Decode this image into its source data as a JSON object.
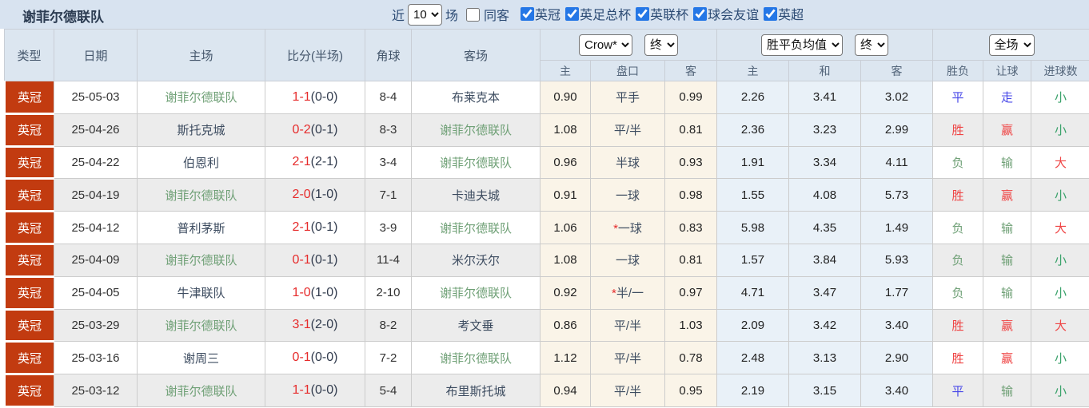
{
  "header": {
    "title": "谢菲尔德联队",
    "recent_label": "近",
    "recent_value": "10",
    "matches_label": "场",
    "same_venue_label": "同客",
    "same_venue_checked": false,
    "leagues": [
      {
        "label": "英冠",
        "checked": true
      },
      {
        "label": "英足总杯",
        "checked": true
      },
      {
        "label": "英联杯",
        "checked": true
      },
      {
        "label": "球会友谊",
        "checked": true
      },
      {
        "label": "英超",
        "checked": true
      }
    ]
  },
  "table": {
    "columns": {
      "type": "类型",
      "date": "日期",
      "home": "主场",
      "score": "比分(半场)",
      "corner": "角球",
      "away": "客场",
      "odds_home": "主",
      "handicap": "盘口",
      "odds_away": "客",
      "avg_home": "主",
      "avg_draw": "和",
      "avg_away": "客",
      "wdl": "胜负",
      "let_goal": "让球",
      "goals": "进球数"
    },
    "selects": {
      "odds_company": "Crow*",
      "odds_state": "终",
      "avg_label": "胜平负均值",
      "avg_state": "终",
      "scope": "全场"
    },
    "rows": [
      {
        "type": "英冠",
        "date": "25-05-03",
        "home": "谢菲尔德联队",
        "home_self": true,
        "score": "1-1",
        "half": "(0-0)",
        "corner": "8-4",
        "away": "布莱克本",
        "away_self": false,
        "odds_home": "0.90",
        "handicap_star": "",
        "handicap": "平手",
        "odds_away": "0.99",
        "avg_win": "2.26",
        "avg_draw": "3.41",
        "avg_lose": "3.02",
        "wdl": "平",
        "wdl_class": "draw",
        "let": "走",
        "let_class": "push",
        "goal": "小",
        "goal_class": "under"
      },
      {
        "type": "英冠",
        "date": "25-04-26",
        "home": "斯托克城",
        "home_self": false,
        "score": "0-2",
        "half": "(0-1)",
        "corner": "8-3",
        "away": "谢菲尔德联队",
        "away_self": true,
        "odds_home": "1.08",
        "handicap_star": "",
        "handicap": "平/半",
        "odds_away": "0.81",
        "avg_win": "2.36",
        "avg_draw": "3.23",
        "avg_lose": "2.99",
        "wdl": "胜",
        "wdl_class": "win",
        "let": "赢",
        "let_class": "win",
        "goal": "小",
        "goal_class": "under"
      },
      {
        "type": "英冠",
        "date": "25-04-22",
        "home": "伯恩利",
        "home_self": false,
        "score": "2-1",
        "half": "(2-1)",
        "corner": "3-4",
        "away": "谢菲尔德联队",
        "away_self": true,
        "odds_home": "0.96",
        "handicap_star": "",
        "handicap": "半球",
        "odds_away": "0.93",
        "avg_win": "1.91",
        "avg_draw": "3.34",
        "avg_lose": "4.11",
        "wdl": "负",
        "wdl_class": "lose",
        "let": "输",
        "let_class": "lose",
        "goal": "大",
        "goal_class": "over"
      },
      {
        "type": "英冠",
        "date": "25-04-19",
        "home": "谢菲尔德联队",
        "home_self": true,
        "score": "2-0",
        "half": "(1-0)",
        "corner": "7-1",
        "away": "卡迪夫城",
        "away_self": false,
        "odds_home": "0.91",
        "handicap_star": "",
        "handicap": "一球",
        "odds_away": "0.98",
        "avg_win": "1.55",
        "avg_draw": "4.08",
        "avg_lose": "5.73",
        "wdl": "胜",
        "wdl_class": "win",
        "let": "赢",
        "let_class": "win",
        "goal": "小",
        "goal_class": "under"
      },
      {
        "type": "英冠",
        "date": "25-04-12",
        "home": "普利茅斯",
        "home_self": false,
        "score": "2-1",
        "half": "(0-1)",
        "corner": "3-9",
        "away": "谢菲尔德联队",
        "away_self": true,
        "odds_home": "1.06",
        "handicap_star": "*",
        "handicap": "一球",
        "odds_away": "0.83",
        "avg_win": "5.98",
        "avg_draw": "4.35",
        "avg_lose": "1.49",
        "wdl": "负",
        "wdl_class": "lose",
        "let": "输",
        "let_class": "lose",
        "goal": "大",
        "goal_class": "over"
      },
      {
        "type": "英冠",
        "date": "25-04-09",
        "home": "谢菲尔德联队",
        "home_self": true,
        "score": "0-1",
        "half": "(0-1)",
        "corner": "11-4",
        "away": "米尔沃尔",
        "away_self": false,
        "odds_home": "1.08",
        "handicap_star": "",
        "handicap": "一球",
        "odds_away": "0.81",
        "avg_win": "1.57",
        "avg_draw": "3.84",
        "avg_lose": "5.93",
        "wdl": "负",
        "wdl_class": "lose",
        "let": "输",
        "let_class": "lose",
        "goal": "小",
        "goal_class": "under"
      },
      {
        "type": "英冠",
        "date": "25-04-05",
        "home": "牛津联队",
        "home_self": false,
        "score": "1-0",
        "half": "(1-0)",
        "corner": "2-10",
        "away": "谢菲尔德联队",
        "away_self": true,
        "odds_home": "0.92",
        "handicap_star": "*",
        "handicap": "半/一",
        "odds_away": "0.97",
        "avg_win": "4.71",
        "avg_draw": "3.47",
        "avg_lose": "1.77",
        "wdl": "负",
        "wdl_class": "lose",
        "let": "输",
        "let_class": "lose",
        "goal": "小",
        "goal_class": "under"
      },
      {
        "type": "英冠",
        "date": "25-03-29",
        "home": "谢菲尔德联队",
        "home_self": true,
        "score": "3-1",
        "half": "(2-0)",
        "corner": "8-2",
        "away": "考文垂",
        "away_self": false,
        "odds_home": "0.86",
        "handicap_star": "",
        "handicap": "平/半",
        "odds_away": "1.03",
        "avg_win": "2.09",
        "avg_draw": "3.42",
        "avg_lose": "3.40",
        "wdl": "胜",
        "wdl_class": "win",
        "let": "赢",
        "let_class": "win",
        "goal": "大",
        "goal_class": "over"
      },
      {
        "type": "英冠",
        "date": "25-03-16",
        "home": "谢周三",
        "home_self": false,
        "score": "0-1",
        "half": "(0-0)",
        "corner": "7-2",
        "away": "谢菲尔德联队",
        "away_self": true,
        "odds_home": "1.12",
        "handicap_star": "",
        "handicap": "平/半",
        "odds_away": "0.78",
        "avg_win": "2.48",
        "avg_draw": "3.13",
        "avg_lose": "2.90",
        "wdl": "胜",
        "wdl_class": "win",
        "let": "赢",
        "let_class": "win",
        "goal": "小",
        "goal_class": "under"
      },
      {
        "type": "英冠",
        "date": "25-03-12",
        "home": "谢菲尔德联队",
        "home_self": true,
        "score": "1-1",
        "half": "(0-0)",
        "corner": "5-4",
        "away": "布里斯托城",
        "away_self": false,
        "odds_home": "0.94",
        "handicap_star": "",
        "handicap": "平/半",
        "odds_away": "0.95",
        "avg_win": "2.19",
        "avg_draw": "3.15",
        "avg_lose": "3.40",
        "wdl": "平",
        "wdl_class": "draw",
        "let": "输",
        "let_class": "lose",
        "goal": "小",
        "goal_class": "under"
      }
    ]
  },
  "colors": {
    "topbar_bg": "#d8e3f0",
    "header_bg": "#dce6f0",
    "border": "#cccccc",
    "row_alt_bg": "#ececec",
    "odds_col_bg": "#faf4e8",
    "avg_col_bg": "#e9f1f8",
    "type_badge_bg": "#c23b10",
    "self_team_green": "#6fa076",
    "score_red": "#e62b2b",
    "win_red": "#ef4444",
    "draw_blue": "#4747e8",
    "lose_green": "#6fa076",
    "over_red": "#ef4444",
    "under_green": "#38a169",
    "checkbox_accent": "#2577e6"
  }
}
